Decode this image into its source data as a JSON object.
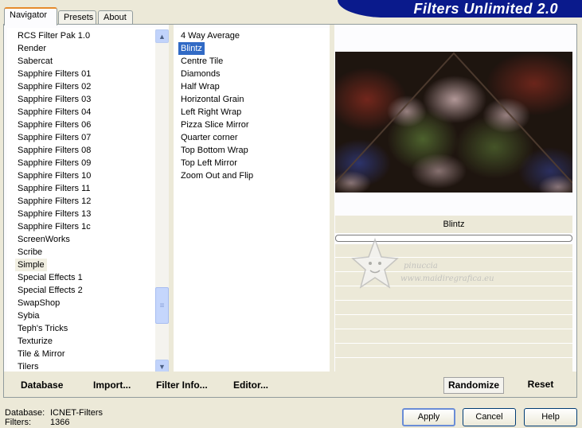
{
  "tabs": [
    "Navigator",
    "Presets",
    "About"
  ],
  "banner_title": "Filters Unlimited 2.0",
  "categories": [
    "RCS Filter Pak 1.0",
    "Render",
    "Sabercat",
    "Sapphire Filters 01",
    "Sapphire Filters 02",
    "Sapphire Filters 03",
    "Sapphire Filters 04",
    "Sapphire Filters 06",
    "Sapphire Filters 07",
    "Sapphire Filters 08",
    "Sapphire Filters 09",
    "Sapphire Filters 10",
    "Sapphire Filters 11",
    "Sapphire Filters 12",
    "Sapphire Filters 13",
    "Sapphire Filters 1c",
    "ScreenWorks",
    "Scribe",
    "Simple",
    "Special Effects 1",
    "Special Effects 2",
    "SwapShop",
    "Sybia",
    "Teph's Tricks",
    "Texturize",
    "Tile & Mirror",
    "Tilers"
  ],
  "selected_category": "Simple",
  "filters": [
    "4 Way Average",
    "Blintz",
    "Centre Tile",
    "Diamonds",
    "Half Wrap",
    "Horizontal Grain",
    "Left Right Wrap",
    "Pizza Slice Mirror",
    "Quarter corner",
    "Top Bottom Wrap",
    "Top Left Mirror",
    "Zoom Out and Flip"
  ],
  "selected_filter": "Blintz",
  "filter_name_label": "Blintz",
  "left_buttons": {
    "database": "Database",
    "import": "Import...",
    "filter_info": "Filter Info...",
    "editor": "Editor..."
  },
  "right_buttons": {
    "randomize": "Randomize",
    "reset": "Reset"
  },
  "watermark": {
    "line1": "pinuccia",
    "line2": "www.maidiregrafica.eu"
  },
  "status": {
    "database_label": "Database:",
    "database_value": "ICNET-Filters",
    "filters_label": "Filters:",
    "filters_value": "1366"
  },
  "dialog_buttons": {
    "apply": "Apply",
    "cancel": "Cancel",
    "help": "Help"
  },
  "colors": {
    "banner": "#0a1a8c",
    "selection": "#316ac5",
    "active_tab_accent": "#e68b2c"
  }
}
